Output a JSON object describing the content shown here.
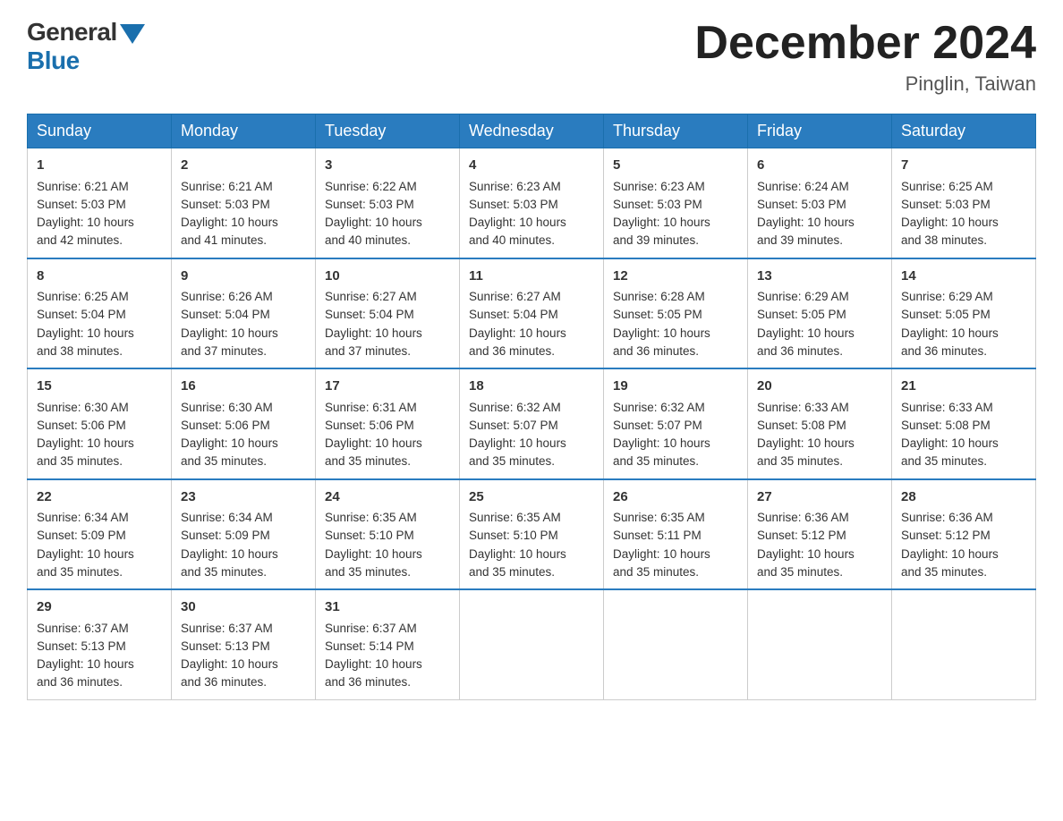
{
  "logo": {
    "general": "General",
    "blue": "Blue"
  },
  "title": "December 2024",
  "location": "Pinglin, Taiwan",
  "weekdays": [
    "Sunday",
    "Monday",
    "Tuesday",
    "Wednesday",
    "Thursday",
    "Friday",
    "Saturday"
  ],
  "weeks": [
    [
      {
        "day": 1,
        "sunrise": "6:21 AM",
        "sunset": "5:03 PM",
        "daylight": "10 hours and 42 minutes."
      },
      {
        "day": 2,
        "sunrise": "6:21 AM",
        "sunset": "5:03 PM",
        "daylight": "10 hours and 41 minutes."
      },
      {
        "day": 3,
        "sunrise": "6:22 AM",
        "sunset": "5:03 PM",
        "daylight": "10 hours and 40 minutes."
      },
      {
        "day": 4,
        "sunrise": "6:23 AM",
        "sunset": "5:03 PM",
        "daylight": "10 hours and 40 minutes."
      },
      {
        "day": 5,
        "sunrise": "6:23 AM",
        "sunset": "5:03 PM",
        "daylight": "10 hours and 39 minutes."
      },
      {
        "day": 6,
        "sunrise": "6:24 AM",
        "sunset": "5:03 PM",
        "daylight": "10 hours and 39 minutes."
      },
      {
        "day": 7,
        "sunrise": "6:25 AM",
        "sunset": "5:03 PM",
        "daylight": "10 hours and 38 minutes."
      }
    ],
    [
      {
        "day": 8,
        "sunrise": "6:25 AM",
        "sunset": "5:04 PM",
        "daylight": "10 hours and 38 minutes."
      },
      {
        "day": 9,
        "sunrise": "6:26 AM",
        "sunset": "5:04 PM",
        "daylight": "10 hours and 37 minutes."
      },
      {
        "day": 10,
        "sunrise": "6:27 AM",
        "sunset": "5:04 PM",
        "daylight": "10 hours and 37 minutes."
      },
      {
        "day": 11,
        "sunrise": "6:27 AM",
        "sunset": "5:04 PM",
        "daylight": "10 hours and 36 minutes."
      },
      {
        "day": 12,
        "sunrise": "6:28 AM",
        "sunset": "5:05 PM",
        "daylight": "10 hours and 36 minutes."
      },
      {
        "day": 13,
        "sunrise": "6:29 AM",
        "sunset": "5:05 PM",
        "daylight": "10 hours and 36 minutes."
      },
      {
        "day": 14,
        "sunrise": "6:29 AM",
        "sunset": "5:05 PM",
        "daylight": "10 hours and 36 minutes."
      }
    ],
    [
      {
        "day": 15,
        "sunrise": "6:30 AM",
        "sunset": "5:06 PM",
        "daylight": "10 hours and 35 minutes."
      },
      {
        "day": 16,
        "sunrise": "6:30 AM",
        "sunset": "5:06 PM",
        "daylight": "10 hours and 35 minutes."
      },
      {
        "day": 17,
        "sunrise": "6:31 AM",
        "sunset": "5:06 PM",
        "daylight": "10 hours and 35 minutes."
      },
      {
        "day": 18,
        "sunrise": "6:32 AM",
        "sunset": "5:07 PM",
        "daylight": "10 hours and 35 minutes."
      },
      {
        "day": 19,
        "sunrise": "6:32 AM",
        "sunset": "5:07 PM",
        "daylight": "10 hours and 35 minutes."
      },
      {
        "day": 20,
        "sunrise": "6:33 AM",
        "sunset": "5:08 PM",
        "daylight": "10 hours and 35 minutes."
      },
      {
        "day": 21,
        "sunrise": "6:33 AM",
        "sunset": "5:08 PM",
        "daylight": "10 hours and 35 minutes."
      }
    ],
    [
      {
        "day": 22,
        "sunrise": "6:34 AM",
        "sunset": "5:09 PM",
        "daylight": "10 hours and 35 minutes."
      },
      {
        "day": 23,
        "sunrise": "6:34 AM",
        "sunset": "5:09 PM",
        "daylight": "10 hours and 35 minutes."
      },
      {
        "day": 24,
        "sunrise": "6:35 AM",
        "sunset": "5:10 PM",
        "daylight": "10 hours and 35 minutes."
      },
      {
        "day": 25,
        "sunrise": "6:35 AM",
        "sunset": "5:10 PM",
        "daylight": "10 hours and 35 minutes."
      },
      {
        "day": 26,
        "sunrise": "6:35 AM",
        "sunset": "5:11 PM",
        "daylight": "10 hours and 35 minutes."
      },
      {
        "day": 27,
        "sunrise": "6:36 AM",
        "sunset": "5:12 PM",
        "daylight": "10 hours and 35 minutes."
      },
      {
        "day": 28,
        "sunrise": "6:36 AM",
        "sunset": "5:12 PM",
        "daylight": "10 hours and 35 minutes."
      }
    ],
    [
      {
        "day": 29,
        "sunrise": "6:37 AM",
        "sunset": "5:13 PM",
        "daylight": "10 hours and 36 minutes."
      },
      {
        "day": 30,
        "sunrise": "6:37 AM",
        "sunset": "5:13 PM",
        "daylight": "10 hours and 36 minutes."
      },
      {
        "day": 31,
        "sunrise": "6:37 AM",
        "sunset": "5:14 PM",
        "daylight": "10 hours and 36 minutes."
      },
      null,
      null,
      null,
      null
    ]
  ],
  "labels": {
    "sunrise": "Sunrise:",
    "sunset": "Sunset:",
    "daylight": "Daylight:"
  }
}
